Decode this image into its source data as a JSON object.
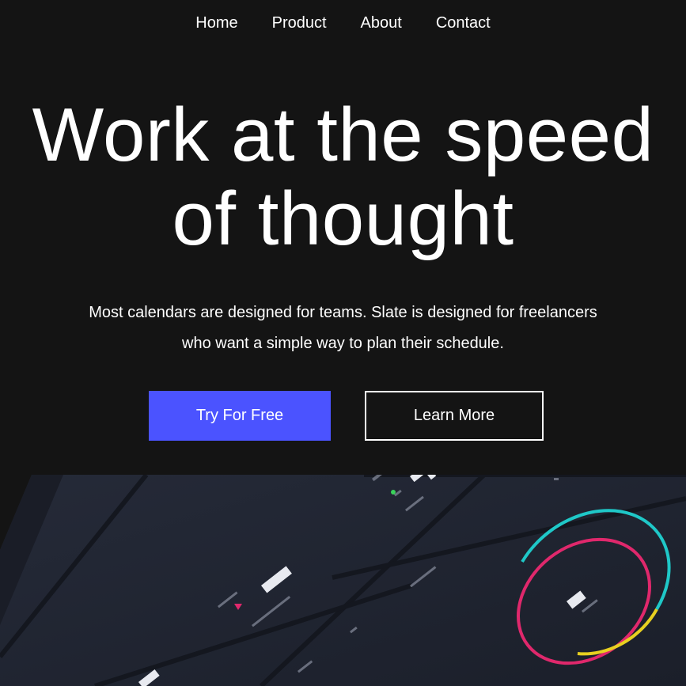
{
  "nav": {
    "items": [
      {
        "label": "Home"
      },
      {
        "label": "Product"
      },
      {
        "label": "About"
      },
      {
        "label": "Contact"
      }
    ]
  },
  "hero": {
    "title_line1": "Work at the speed",
    "title_line2": "of thought",
    "subtitle_line1": "Most calendars are designed for teams. Slate is designed for freelancers",
    "subtitle_line2": "who want a simple way to plan their schedule.",
    "primary_button": "Try For Free",
    "secondary_button": "Learn More"
  },
  "colors": {
    "background": "#141414",
    "accent": "#4b53ff",
    "ring_cyan": "#1fc8c8",
    "ring_magenta": "#e0286c",
    "ring_yellow": "#e8d020"
  },
  "mockup": {
    "icons": [
      "dashboard-preview-image",
      "donut-chart-icon"
    ]
  }
}
